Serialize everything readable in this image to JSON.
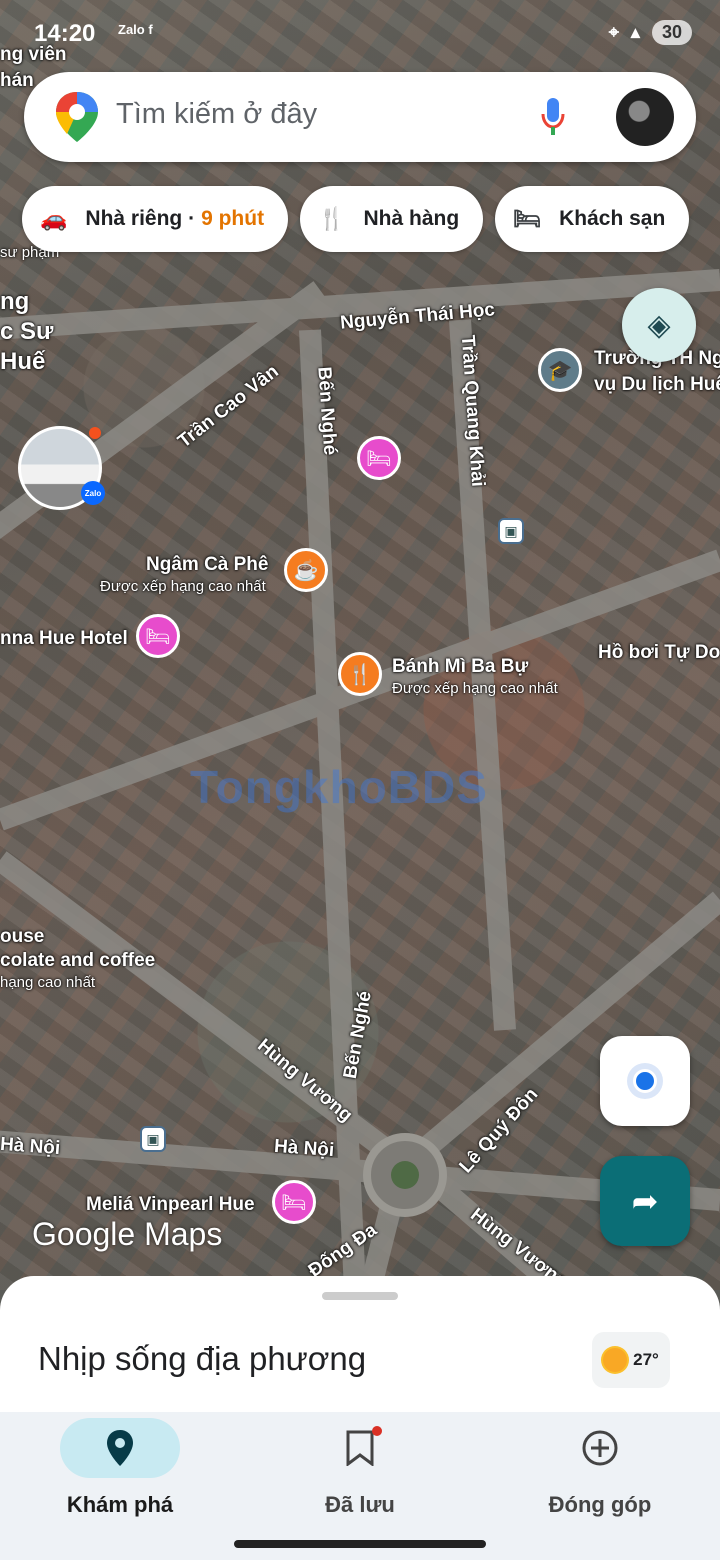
{
  "status_bar": {
    "time": "14:20",
    "app_icons": "Zalo f",
    "battery": "30"
  },
  "search": {
    "placeholder": "Tìm kiếm ở đây"
  },
  "chips": [
    {
      "icon": "car-icon",
      "label": "Nhà riêng ·",
      "eta": "9 phút"
    },
    {
      "icon": "restaurant-icon",
      "label": "Nhà hàng"
    },
    {
      "icon": "hotel-icon",
      "label": "Khách sạn"
    }
  ],
  "map": {
    "streets": [
      "Nguyễn Thái Học",
      "Trần Cao Vân",
      "Bến Nghé",
      "Trần Quang Khải",
      "Hùng Vương",
      "Hà Nội",
      "Lê Quý Đôn",
      "Đống Đa"
    ],
    "places": {
      "school": "Trường TH Nghiệp vụ Du lịch Huế",
      "school_line1": "Trường TH Ng",
      "school_line2": "vụ Du lịch Huế",
      "cafe": "Ngâm Cà Phê",
      "cafe_sub": "Được xếp hạng cao nhất",
      "hotel_left": "nna Hue Hotel",
      "banhmi": "Bánh Mì Ba Bự",
      "banhmi_sub": "Được xếp hạng cao nhất",
      "pool": "Hồ bơi Tự Do",
      "house": "ouse",
      "chocolate": "colate and coffee",
      "chocolate_sub": "hạng cao nhất",
      "melia": "Meliá Vinpearl Hue",
      "left_top1": "ng viên",
      "left_top2": "hán",
      "left_mid1": "ng",
      "left_mid2": "c Sư",
      "left_mid3": "Huế",
      "supham": "sư phạm"
    },
    "watermark": "TongkhoBDS",
    "logo": "Google Maps"
  },
  "sheet": {
    "title": "Nhịp sống địa phương",
    "temperature": "27°"
  },
  "nav": [
    {
      "label": "Khám phá",
      "active": true
    },
    {
      "label": "Đã lưu",
      "active": false
    },
    {
      "label": "Đóng góp",
      "active": false
    }
  ]
}
